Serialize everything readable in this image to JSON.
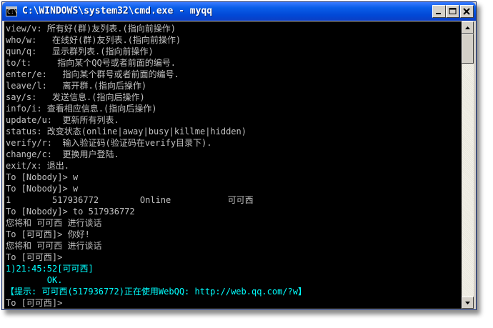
{
  "window": {
    "title": "C:\\WINDOWS\\system32\\cmd.exe - myqq",
    "icon_name": "cmd-icon",
    "icon_text": "C:\\",
    "controls": [
      "minimize-icon",
      "maximize-icon",
      "close-icon"
    ]
  },
  "console": {
    "lines": [
      {
        "text": "view/v: 所有好(群)友列表.(指向前操作)"
      },
      {
        "text": "who/w:   在线好(群)友列表.(指向前操作)"
      },
      {
        "text": "qun/q:   显示群列表.(指向前操作)"
      },
      {
        "text": "to/t:     指向某个QQ号或者前面的编号."
      },
      {
        "text": "enter/e:   指向某个群号或者前面的编号."
      },
      {
        "text": "leave/l:   离开群.(指向后操作)"
      },
      {
        "text": "say/s:   发送信息.(指向后操作)"
      },
      {
        "text": "info/i: 查看相应信息.(指向后操作)"
      },
      {
        "text": "update/u:  更新所有列表."
      },
      {
        "text": "status: 改变状态(online|away|busy|killme|hidden)"
      },
      {
        "text": "verify/r:  输入验证码(验证码在verify目录下)."
      },
      {
        "text": "change/c:  更换用户登陆."
      },
      {
        "text": "exit/x: 退出."
      },
      {
        "text": "To [Nobody]> w"
      },
      {
        "text": "To [Nobody]> w"
      },
      {
        "text": "1        517936772        Online           可可西"
      },
      {
        "text": "To [Nobody]> to 517936772"
      },
      {
        "text": "您将和 可可西 进行谈话"
      },
      {
        "text": "To [可可西]> 你好!"
      },
      {
        "text": "您将和 可可西 进行谈话"
      },
      {
        "text": "To [可可西]>"
      },
      {
        "text": "1)21:45:52[可可西]",
        "color": "cyan"
      },
      {
        "text": "        OK.",
        "color": "cyan"
      },
      {
        "text": "【提示: 可可西(517936772)正在使用WebQQ: http://web.qq.com/?w】",
        "color": "cyan"
      },
      {
        "text": "To [可可西]>"
      }
    ]
  },
  "scrollbar": {
    "up_icon": "scroll-up-arrow-icon",
    "down_icon": "scroll-down-arrow-icon"
  },
  "colors": {
    "console_bg": "#000000",
    "console_text": "#c0c0c0",
    "highlight_text": "#00ffff",
    "titlebar": "#0a5ee8"
  }
}
